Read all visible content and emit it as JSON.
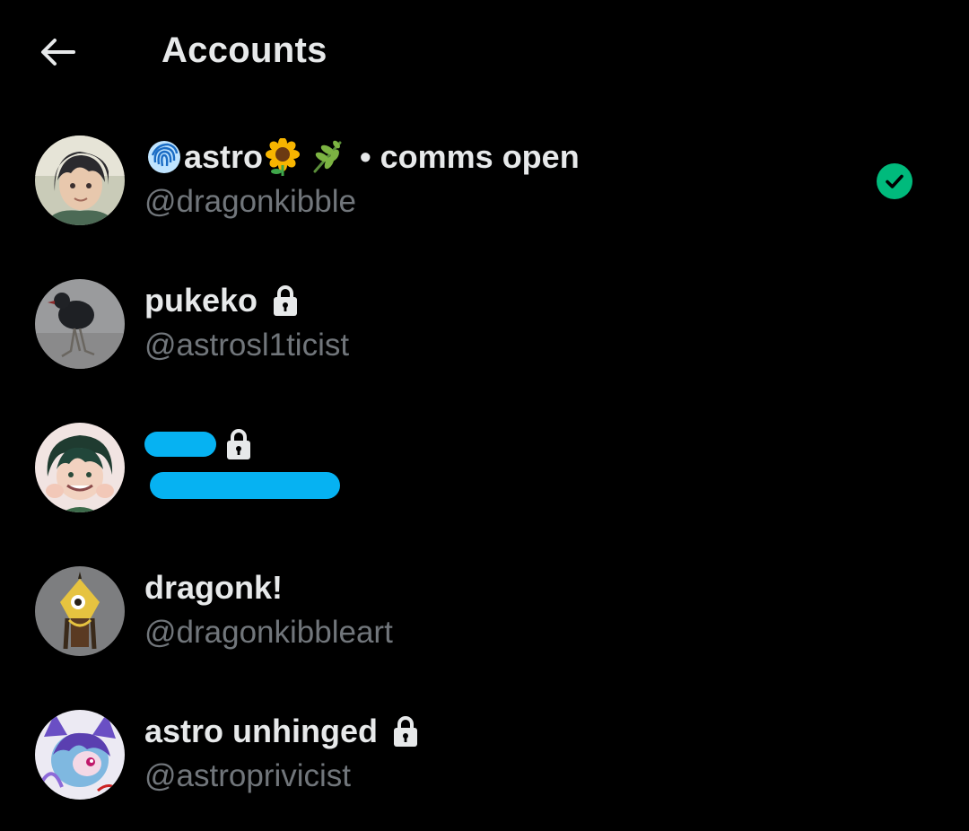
{
  "header": {
    "title": "Accounts",
    "back_icon": "arrow-left-icon"
  },
  "colors": {
    "background": "#000000",
    "primary_text": "#e7e9ea",
    "secondary_text": "#71767b",
    "check_green": "#00ba7c",
    "redaction_blue": "#06b2f2"
  },
  "accounts": [
    {
      "display_name": "astro",
      "name_suffix": "comms open",
      "separator": "•",
      "emojis": [
        "fingerprint-icon",
        "sunflower-icon",
        "herb-icon"
      ],
      "handle": "@dragonkibble",
      "active": true,
      "locked": false
    },
    {
      "display_name": "pukeko",
      "handle": "@astrosl1ticist",
      "active": false,
      "locked": true
    },
    {
      "display_name": "",
      "handle": "",
      "redacted": true,
      "active": false,
      "locked": true
    },
    {
      "display_name": "dragonk!",
      "handle": "@dragonkibbleart",
      "active": false,
      "locked": false
    },
    {
      "display_name": "astro unhinged",
      "handle": "@astroprivicist",
      "active": false,
      "locked": true
    }
  ]
}
